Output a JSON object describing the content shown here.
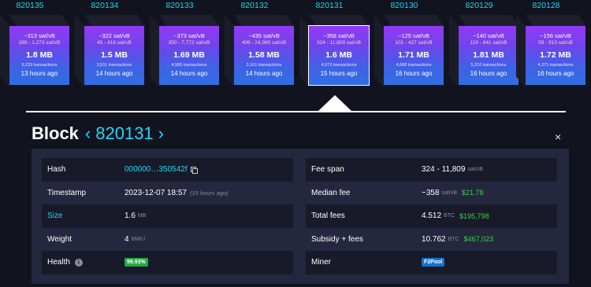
{
  "blocks": [
    {
      "height": "820135",
      "median_fee": "~313 sat/vB",
      "fee_range": "289 - 1,273 sat/vB",
      "size": "1.8 MB",
      "tx_count": "5,233 transactions",
      "age": "13 hours ago"
    },
    {
      "height": "820134",
      "median_fee": "~322 sat/vB",
      "fee_range": "45 - 418 sat/vB",
      "size": "1.5 MB",
      "tx_count": "3,511 transactions",
      "age": "14 hours ago"
    },
    {
      "height": "820133",
      "median_fee": "~373 sat/vB",
      "fee_range": "350 - 7,772 sat/vB",
      "size": "1.69 MB",
      "tx_count": "4,585 transactions",
      "age": "14 hours ago"
    },
    {
      "height": "820132",
      "median_fee": "~435 sat/vB",
      "fee_range": "406 - 24,960 sat/vB",
      "size": "1.58 MB",
      "tx_count": "3,161 transactions",
      "age": "14 hours ago"
    },
    {
      "height": "820131",
      "median_fee": "~358 sat/vB",
      "fee_range": "324 - 11,809 sat/vB",
      "size": "1.6 MB",
      "tx_count": "4,073 transactions",
      "age": "15 hours ago"
    },
    {
      "height": "820130",
      "median_fee": "~125 sat/vB",
      "fee_range": "101 - 427 sat/vB",
      "size": "1.71 MB",
      "tx_count": "4,688 transactions",
      "age": "16 hours ago"
    },
    {
      "height": "820129",
      "median_fee": "~140 sat/vB",
      "fee_range": "119 - 641 sat/vB",
      "size": "1.81 MB",
      "tx_count": "5,210 transactions",
      "age": "16 hours ago"
    },
    {
      "height": "820128",
      "median_fee": "~156 sat/vB",
      "fee_range": "59 - 910 sat/vB",
      "size": "1.72 MB",
      "tx_count": "4,371 transactions",
      "age": "16 hours ago"
    }
  ],
  "header": {
    "title": "Block",
    "prev_icon": "chevron-left-icon",
    "next_icon": "chevron-right-icon",
    "height": "820131",
    "close_icon": "close-icon",
    "prev_glyph": "‹",
    "next_glyph": "›",
    "close_glyph": "×"
  },
  "details_left": {
    "hash": {
      "label": "Hash",
      "value": "000000…350542f",
      "copy_icon": "copy-icon"
    },
    "timestamp": {
      "label": "Timestamp",
      "value": "2023-12-07 18:57",
      "relative": "(15 hours ago)"
    },
    "size": {
      "label": "Size",
      "value": "1.6",
      "unit": "MB"
    },
    "weight": {
      "label": "Weight",
      "value": "4",
      "unit": "MWU"
    },
    "health": {
      "label": "Health",
      "value": "99.93%",
      "info_icon": "info-icon",
      "info_glyph": "i"
    }
  },
  "details_right": {
    "fee_span": {
      "label": "Fee span",
      "value": "324 - 11,809",
      "unit": "sat/vB"
    },
    "median_fee": {
      "label": "Median fee",
      "value": "~358",
      "unit": "sat/vB",
      "usd": "$21.78"
    },
    "total_fees": {
      "label": "Total fees",
      "value": "4.512",
      "unit": "BTC",
      "usd": "$195,798"
    },
    "subsidy_fees": {
      "label": "Subsidy + fees",
      "value": "10.762",
      "unit": "BTC",
      "usd": "$467,023"
    },
    "miner": {
      "label": "Miner",
      "value": "F2Pool"
    }
  },
  "colors": {
    "accent": "#1bd8f4",
    "background": "#11131f",
    "panel": "#24273e",
    "green": "#3bcc49"
  }
}
